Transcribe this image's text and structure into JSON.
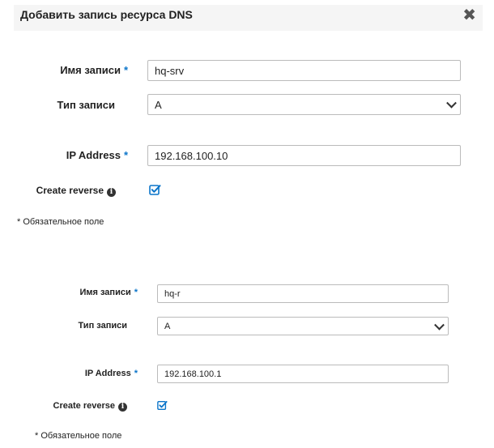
{
  "dialog": {
    "title": "Добавить запись ресурса DNS",
    "close_symbol": "✖",
    "close_icon": "close-icon"
  },
  "form1": {
    "name_label": "Имя записи",
    "required_mark": "*",
    "name_value": "hq-srv",
    "type_label": "Тип записи",
    "type_value": "A",
    "ip_label": "IP Address",
    "ip_value": "192.168.100.10",
    "reverse_label": "Create reverse",
    "reverse_checked": true,
    "required_note": "* Обязательное поле"
  },
  "form2": {
    "name_label": "Имя записи",
    "required_mark": "*",
    "name_value": "hq-r",
    "type_label": "Тип записи",
    "type_value": "A",
    "ip_label": "IP Address",
    "ip_value": "192.168.100.1",
    "reverse_label": "Create reverse",
    "reverse_checked": true,
    "required_note": "* Обязательное поле"
  },
  "colors": {
    "accent": "#0a74c9",
    "header_bg": "#f5f5f5",
    "border": "#bbbbbb"
  },
  "icons": {
    "info": "info-icon",
    "checkbox": "checkbox-checked-icon",
    "dropdown": "chevron-down-icon"
  }
}
